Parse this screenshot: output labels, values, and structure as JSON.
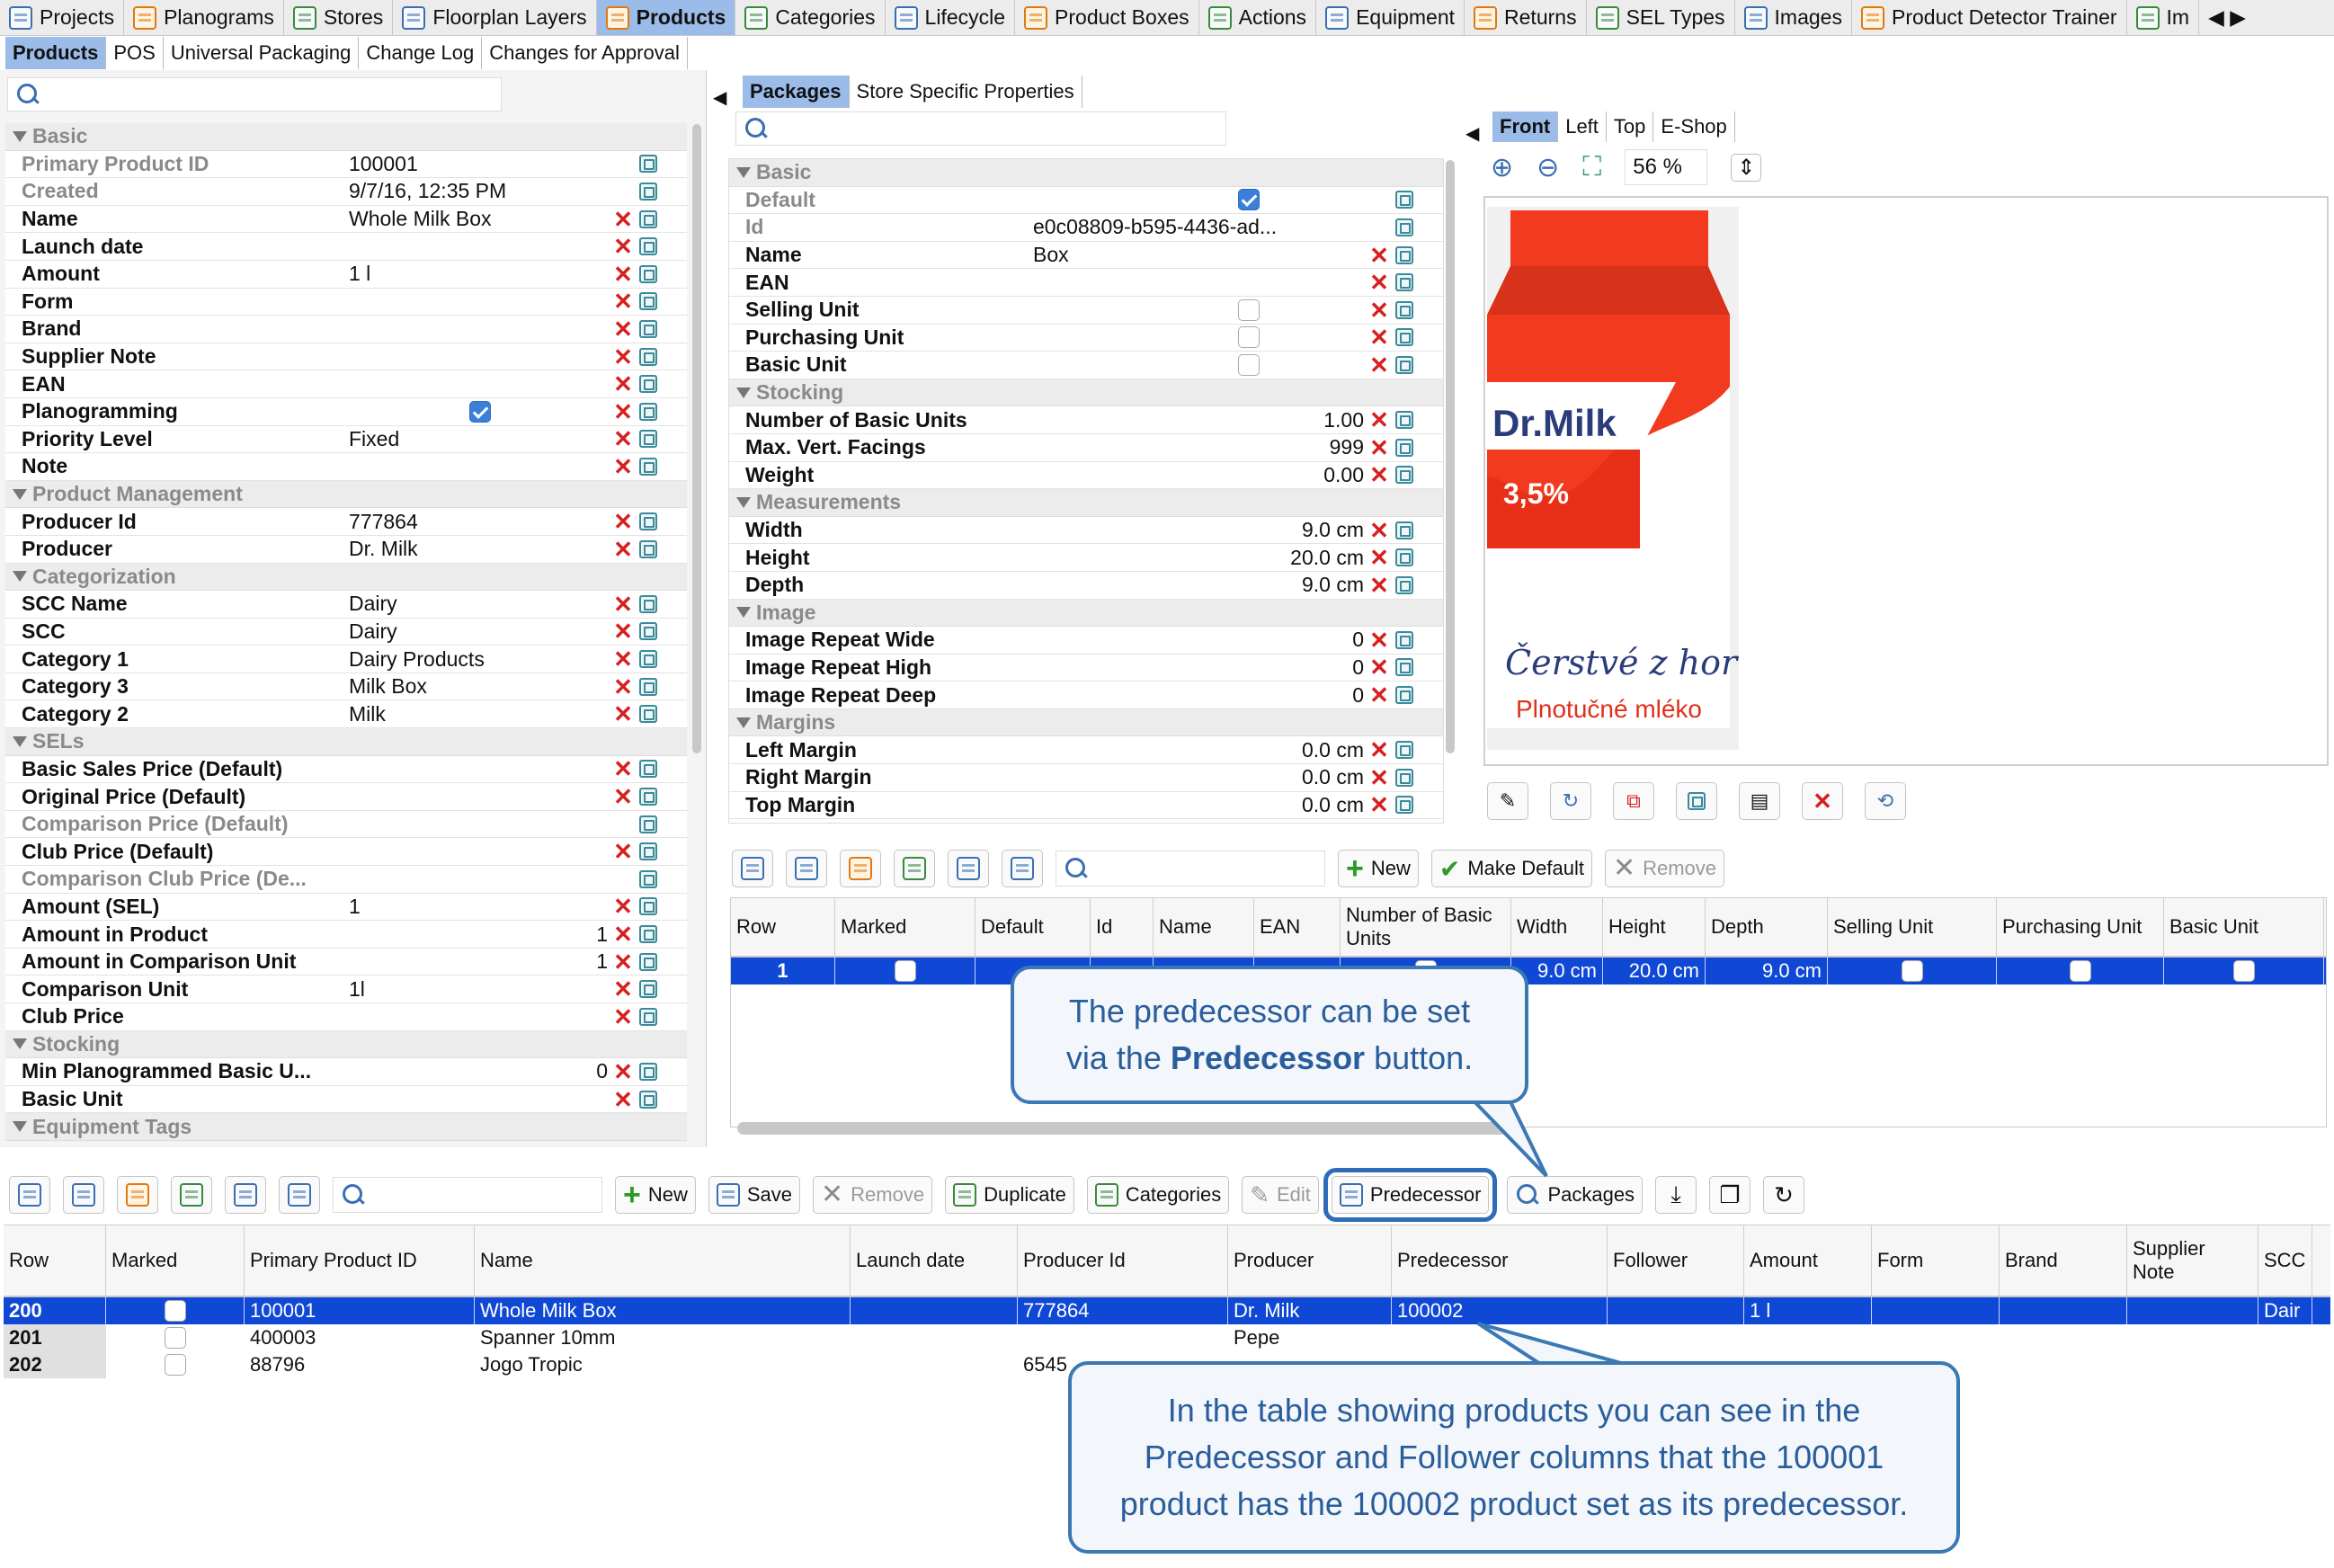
{
  "top_nav": [
    {
      "label": "Projects",
      "icon": "projects-icon"
    },
    {
      "label": "Planograms",
      "icon": "planograms-icon"
    },
    {
      "label": "Stores",
      "icon": "cart-icon"
    },
    {
      "label": "Floorplan Layers",
      "icon": "layers-icon"
    },
    {
      "label": "Products",
      "icon": "products-icon",
      "active": true
    },
    {
      "label": "Categories",
      "icon": "list-icon"
    },
    {
      "label": "Lifecycle",
      "icon": "lifecycle-icon"
    },
    {
      "label": "Product Boxes",
      "icon": "box-icon"
    },
    {
      "label": "Actions",
      "icon": "clock-icon"
    },
    {
      "label": "Equipment",
      "icon": "equipment-icon"
    },
    {
      "label": "Returns",
      "icon": "returns-icon"
    },
    {
      "label": "SEL Types",
      "icon": "tag-icon"
    },
    {
      "label": "Images",
      "icon": "image-icon"
    },
    {
      "label": "Product Detector Trainer",
      "icon": "trainer-icon"
    },
    {
      "label": "Im",
      "icon": "import-icon"
    }
  ],
  "sub_tabs": [
    "Products",
    "POS",
    "Universal Packaging",
    "Change Log",
    "Changes for Approval"
  ],
  "left_sections": [
    {
      "title": "Basic",
      "rows": [
        {
          "k": "Primary Product ID",
          "v": "100001",
          "dim": true,
          "x": false
        },
        {
          "k": "Created",
          "v": "9/7/16, 12:35 PM",
          "dim": true,
          "x": false
        },
        {
          "k": "Name",
          "v": "Whole Milk Box",
          "x": true
        },
        {
          "k": "Launch date",
          "v": "",
          "x": true
        },
        {
          "k": "Amount",
          "v": "1 l",
          "x": true
        },
        {
          "k": "Form",
          "v": "",
          "x": true
        },
        {
          "k": "Brand",
          "v": "",
          "x": true
        },
        {
          "k": "Supplier Note",
          "v": "",
          "x": true
        },
        {
          "k": "EAN",
          "v": "",
          "x": true
        },
        {
          "k": "Planogramming",
          "v": "",
          "check": true,
          "x": true
        },
        {
          "k": "Priority Level",
          "v": "Fixed",
          "x": true
        },
        {
          "k": "Note",
          "v": "",
          "x": true
        }
      ]
    },
    {
      "title": "Product Management",
      "rows": [
        {
          "k": "Producer Id",
          "v": "777864",
          "x": true
        },
        {
          "k": "Producer",
          "v": "Dr. Milk",
          "x": true
        }
      ]
    },
    {
      "title": "Categorization",
      "rows": [
        {
          "k": "SCC Name",
          "v": "Dairy",
          "x": true
        },
        {
          "k": "SCC",
          "v": "Dairy",
          "x": true
        },
        {
          "k": "Category 1",
          "v": "Dairy Products",
          "x": true
        },
        {
          "k": "Category 3",
          "v": "Milk Box",
          "x": true
        },
        {
          "k": "Category 2",
          "v": "Milk",
          "x": true
        }
      ]
    },
    {
      "title": "SELs",
      "rows": [
        {
          "k": "Basic Sales Price (Default)",
          "v": "",
          "x": true
        },
        {
          "k": "Original Price (Default)",
          "v": "",
          "x": true
        },
        {
          "k": "Comparison Price (Default)",
          "v": "",
          "dim": true,
          "x": false
        },
        {
          "k": "Club Price (Default)",
          "v": "",
          "x": true
        },
        {
          "k": "Comparison Club Price (De...",
          "v": "",
          "dim": true,
          "x": false
        },
        {
          "k": "Amount (SEL)",
          "v": "1",
          "x": true
        },
        {
          "k": "Amount in Product",
          "v": "1",
          "right": true,
          "x": true
        },
        {
          "k": "Amount in Comparison Unit",
          "v": "1",
          "right": true,
          "x": true
        },
        {
          "k": "Comparison Unit",
          "v": "1l",
          "x": true
        },
        {
          "k": "Club Price",
          "v": "",
          "x": true
        }
      ]
    },
    {
      "title": "Stocking",
      "rows": [
        {
          "k": "Min Planogrammed Basic U...",
          "v": "0",
          "right": true,
          "x": true
        },
        {
          "k": "Basic Unit",
          "v": "",
          "x": true
        }
      ]
    },
    {
      "title": "Equipment Tags",
      "rows": []
    }
  ],
  "package_tabs": [
    "Packages",
    "Store Specific Properties"
  ],
  "package_sections": [
    {
      "title": "Basic",
      "rows": [
        {
          "k": "Default",
          "v": "",
          "check": true,
          "checked": true,
          "dim": true,
          "x": false
        },
        {
          "k": "Id",
          "v": "e0c08809-b595-4436-ad...",
          "dim": true,
          "x": false
        },
        {
          "k": "Name",
          "v": "Box",
          "x": true
        },
        {
          "k": "EAN",
          "v": "",
          "x": true
        },
        {
          "k": "Selling Unit",
          "v": "",
          "check": true,
          "checked": false,
          "x": true
        },
        {
          "k": "Purchasing Unit",
          "v": "",
          "check": true,
          "checked": false,
          "x": true
        },
        {
          "k": "Basic Unit",
          "v": "",
          "check": true,
          "checked": false,
          "x": true
        }
      ]
    },
    {
      "title": "Stocking",
      "rows": [
        {
          "k": "Number of Basic Units",
          "v": "1.00",
          "right": true,
          "x": true
        },
        {
          "k": "Max. Vert. Facings",
          "v": "999",
          "right": true,
          "x": true
        },
        {
          "k": "Weight",
          "v": "0.00",
          "right": true,
          "x": true
        }
      ]
    },
    {
      "title": "Measurements",
      "rows": [
        {
          "k": "Width",
          "v": "9.0 cm",
          "right": true,
          "x": true
        },
        {
          "k": "Height",
          "v": "20.0 cm",
          "right": true,
          "x": true
        },
        {
          "k": "Depth",
          "v": "9.0 cm",
          "right": true,
          "x": true
        }
      ]
    },
    {
      "title": "Image",
      "rows": [
        {
          "k": "Image Repeat Wide",
          "v": "0",
          "right": true,
          "x": true
        },
        {
          "k": "Image Repeat High",
          "v": "0",
          "right": true,
          "x": true
        },
        {
          "k": "Image Repeat Deep",
          "v": "0",
          "right": true,
          "x": true
        }
      ]
    },
    {
      "title": "Margins",
      "rows": [
        {
          "k": "Left Margin",
          "v": "0.0 cm",
          "right": true,
          "x": true
        },
        {
          "k": "Right Margin",
          "v": "0.0 cm",
          "right": true,
          "x": true
        },
        {
          "k": "Top Margin",
          "v": "0.0 cm",
          "right": true,
          "x": true
        }
      ]
    }
  ],
  "view_tabs": [
    "Front",
    "Left",
    "Top",
    "E-Shop"
  ],
  "zoom": "56 %",
  "product_image": {
    "brand": "Dr.Milk",
    "fat": "3,5%",
    "slogan": "Čerstvé z hor",
    "subtitle": "Plnotučné mléko",
    "accent": "#f23a1e"
  },
  "package_toolbar": {
    "new": "New",
    "make_default": "Make Default",
    "remove": "Remove"
  },
  "package_table": {
    "headers": [
      "Row",
      "Marked",
      "Default",
      "Id",
      "Name",
      "EAN",
      "Number of Basic Units",
      "Width",
      "Height",
      "Depth",
      "Selling Unit",
      "Purchasing Unit",
      "Basic Unit"
    ],
    "rows": [
      [
        "1",
        "",
        "",
        "",
        "",
        "",
        "",
        "9.0 cm",
        "20.0 cm",
        "9.0 cm",
        "",
        "",
        ""
      ]
    ]
  },
  "product_toolbar": {
    "new": "New",
    "save": "Save",
    "remove": "Remove",
    "duplicate": "Duplicate",
    "categories": "Categories",
    "edit": "Edit",
    "predecessor": "Predecessor",
    "packages": "Packages"
  },
  "product_table": {
    "headers": [
      "Row",
      "Marked",
      "Primary Product ID",
      "Name",
      "Launch date",
      "Producer Id",
      "Producer",
      "Predecessor",
      "Follower",
      "Amount",
      "Form",
      "Brand",
      "Supplier Note",
      "SCC"
    ],
    "rows": [
      [
        "200",
        "",
        "100001",
        "Whole Milk Box",
        "",
        "777864",
        "Dr. Milk",
        "100002",
        "",
        "1 l",
        "",
        "",
        "",
        "Dair"
      ],
      [
        "201",
        "",
        "400003",
        "Spanner 10mm",
        "",
        "",
        "Pepe",
        "",
        "",
        "",
        "",
        "",
        "",
        ""
      ],
      [
        "202",
        "",
        "88796",
        "Jogo Tropic",
        "",
        "6545",
        "",
        "",
        "",
        "",
        "",
        "",
        "",
        ""
      ]
    ]
  },
  "callouts": {
    "predecessor_line1": "The predecessor can be set",
    "predecessor_line2_pre": "via the ",
    "predecessor_line2_bold": "Predecessor",
    "predecessor_line2_post": " button.",
    "table": "In the table showing products you can see in the Predecessor and Follower columns that the 100001 product has the 100002 product set as its predecessor."
  }
}
